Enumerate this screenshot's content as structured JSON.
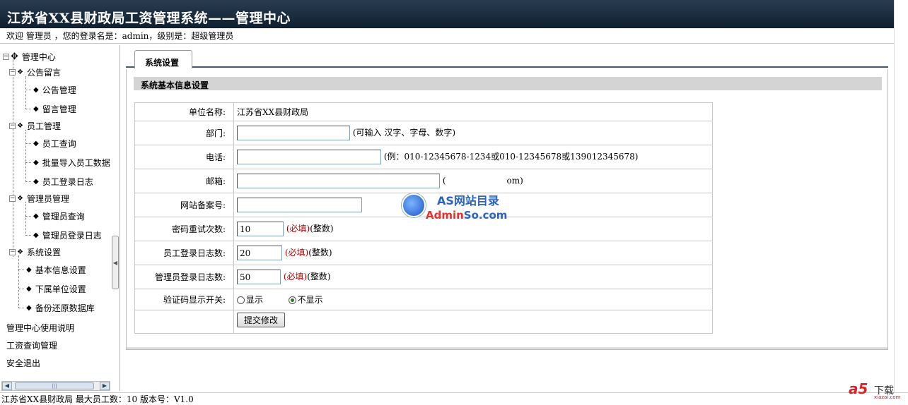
{
  "header": {
    "title": "江苏省XX县财政局工资管理系统——管理中心",
    "welcome": "欢迎 管理员 ，您的登录名是：admin，级别是：超级管理员"
  },
  "sidebar": {
    "root": "管理中心",
    "groups": [
      {
        "label": "公告留言",
        "items": [
          "公告管理",
          "留言管理"
        ]
      },
      {
        "label": "员工管理",
        "items": [
          "员工查询",
          "批量导入员工数据",
          "员工登录日志"
        ]
      },
      {
        "label": "管理员管理",
        "items": [
          "管理员查询",
          "管理员登录日志"
        ]
      },
      {
        "label": "系统设置",
        "items": [
          "基本信息设置",
          "下属单位设置",
          "备份还原数据库"
        ]
      }
    ],
    "links": [
      "管理中心使用说明",
      "工资查询管理",
      "安全退出"
    ]
  },
  "main": {
    "tab": "系统设置",
    "section_title": "系统基本信息设置",
    "form": {
      "unit_label": "单位名称:",
      "unit_value": "江苏省XX县财政局",
      "dept_label": "部门:",
      "dept_value": "",
      "dept_hint": "(可输入 汉字、字母、数字)",
      "phone_label": "电话:",
      "phone_value": "",
      "phone_hint": "(例：010-12345678-1234或010-12345678或139012345678)",
      "email_label": "邮箱:",
      "email_value": "",
      "email_hint_start": "(",
      "email_hint_end": "om)",
      "icp_label": "网站备案号:",
      "icp_value": "",
      "retry_label": "密码重试次数:",
      "retry_value": "10",
      "emp_log_label": "员工登录日志数:",
      "emp_log_value": "20",
      "admin_log_label": "管理员登录日志数:",
      "admin_log_value": "50",
      "required": "(必填)",
      "integer": "(整数)",
      "captcha_label": "验证码显示开关:",
      "captcha_show": "显示",
      "captcha_hide": "不显示",
      "captcha_selected": "不显示",
      "submit": "提交修改"
    }
  },
  "watermark": {
    "top": "AS网站目录",
    "bottom_a": "Admin",
    "bottom_b": "So.com"
  },
  "status": "江苏省XX县财政局 最大员工数：10 版本号：V1.0",
  "corner_logo": {
    "brand": "a5",
    "text": "下载",
    "site": "xiazai.com"
  }
}
